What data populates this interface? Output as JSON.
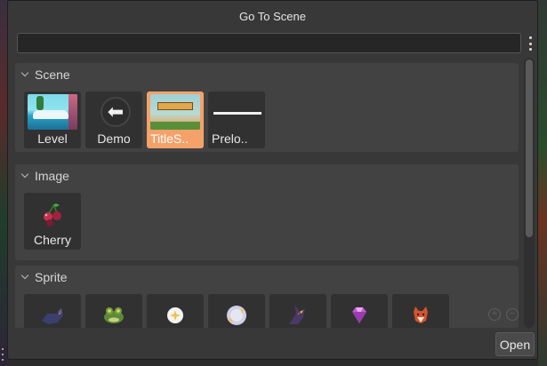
{
  "dialog": {
    "title": "Go To Scene",
    "search": {
      "value": "",
      "placeholder": ""
    },
    "open_label": "Open"
  },
  "sections": [
    {
      "header": "Scene",
      "items": [
        {
          "label": "Level",
          "icon": "level-thumbnail",
          "selected": false
        },
        {
          "label": "Demo",
          "icon": "back-arrow-icon",
          "selected": false
        },
        {
          "label": "TitleS..",
          "icon": "title-screen-thumbnail",
          "selected": true
        },
        {
          "label": "Prelo..",
          "icon": "preloader-thumbnail",
          "selected": false
        }
      ]
    },
    {
      "header": "Image",
      "items": [
        {
          "label": "Cherry",
          "icon": "cherry-icon",
          "selected": false
        }
      ]
    },
    {
      "header": "Sprite",
      "items": [
        {
          "icon": "fox-sprite-icon"
        },
        {
          "icon": "frog-sprite-icon"
        },
        {
          "icon": "sparkle-sprite-icon"
        },
        {
          "icon": "orb-sprite-icon"
        },
        {
          "icon": "eagle-sprite-icon"
        },
        {
          "icon": "gem-sprite-icon"
        },
        {
          "icon": "fox-head-sprite-icon"
        }
      ]
    }
  ],
  "colors": {
    "selected": "#f4a26a",
    "panel": "#424242",
    "dialog": "#383838"
  }
}
